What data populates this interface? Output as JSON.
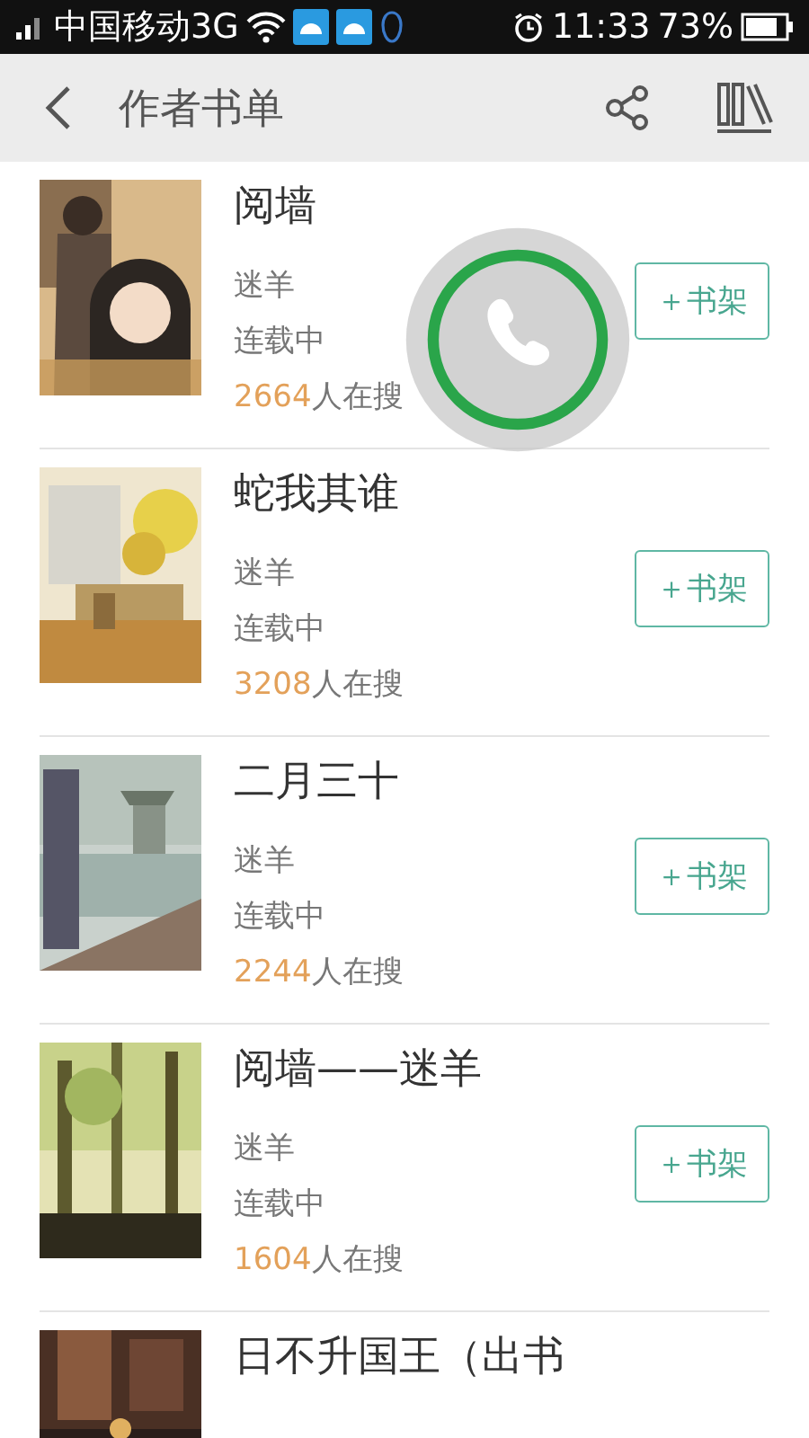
{
  "status_bar": {
    "carrier": "中国移动3G",
    "time": "11:33",
    "battery": "73%"
  },
  "header": {
    "title": "作者书单"
  },
  "books": [
    {
      "title": "阅墙",
      "author": "迷羊",
      "status": "连载中",
      "searchers": "2664",
      "searchers_label": "人在搜",
      "button": "＋书架"
    },
    {
      "title": "蛇我其谁",
      "author": "迷羊",
      "status": "连载中",
      "searchers": "3208",
      "searchers_label": "人在搜",
      "button": "＋书架"
    },
    {
      "title": "二月三十",
      "author": "迷羊",
      "status": "连载中",
      "searchers": "2244",
      "searchers_label": "人在搜",
      "button": "＋书架"
    },
    {
      "title": "阅墙——迷羊",
      "author": "迷羊",
      "status": "连载中",
      "searchers": "1604",
      "searchers_label": "人在搜",
      "button": "＋书架"
    },
    {
      "title": "日不升国王（出书"
    }
  ]
}
